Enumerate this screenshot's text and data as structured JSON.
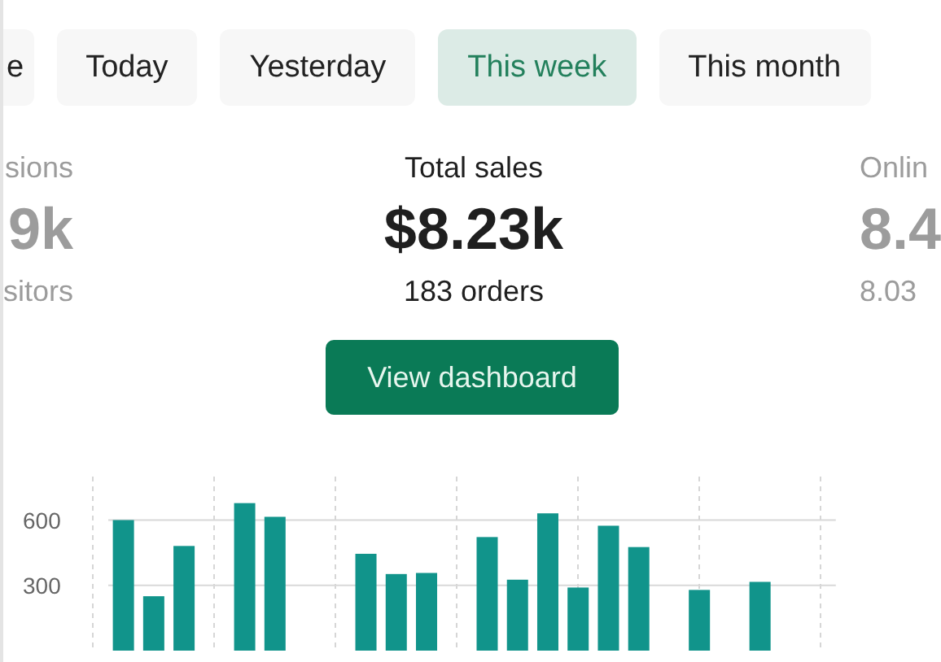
{
  "tabs": [
    {
      "label": "e",
      "selected": false
    },
    {
      "label": "Today",
      "selected": false
    },
    {
      "label": "Yesterday",
      "selected": false
    },
    {
      "label": "This week",
      "selected": true
    },
    {
      "label": "This month",
      "selected": false
    }
  ],
  "metrics": [
    {
      "label": "sions",
      "value": "9k",
      "detail": "sitors",
      "selected": false
    },
    {
      "label": "Total sales",
      "value": "$8.23k",
      "detail": "183 orders",
      "selected": true
    },
    {
      "label": "Onlin",
      "value": "8.4",
      "detail": "8.03",
      "selected": false
    }
  ],
  "button": {
    "label": "View dashboard"
  },
  "chart": {
    "chart_data": {
      "type": "bar",
      "grid": true,
      "ylim": [
        0,
        800
      ],
      "yticks": [
        300,
        600
      ],
      "values": [
        600,
        250,
        481,
        null,
        678,
        615,
        null,
        null,
        445,
        352,
        357,
        null,
        522,
        326,
        631,
        290,
        574,
        476,
        null,
        279,
        null,
        316,
        null,
        null
      ]
    }
  }
}
